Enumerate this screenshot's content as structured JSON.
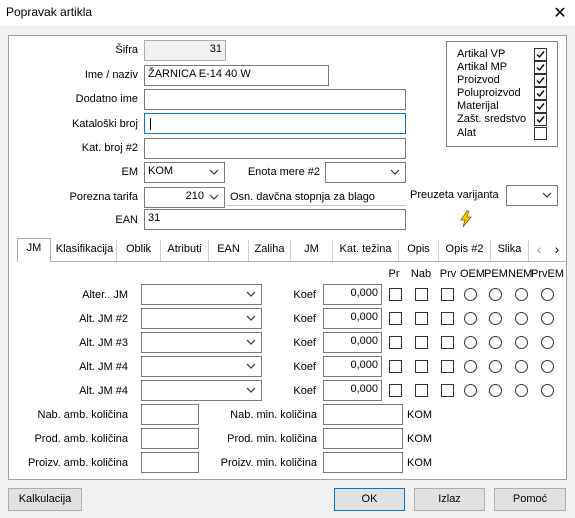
{
  "window": {
    "title": "Popravak artikla"
  },
  "fields": {
    "sifra_label": "Šifra",
    "sifra_value": "31",
    "ime_label": "Ime / naziv",
    "ime_value": "ŽARNICA E-14 40 W",
    "dodatno_label": "Dodatno ime",
    "dodatno_value": "",
    "katalog_label": "Kataloški broj",
    "katalog_value": "",
    "katalog2_label": "Kat. broj #2",
    "katalog2_value": "",
    "em_label": "EM",
    "em_value": "KOM",
    "enota2_label": "Enota mere #2",
    "enota2_value": "",
    "porez_label": "Porezna tarifa",
    "porez_value": "210",
    "porez_desc": "Osn. davčna stopnja za blago",
    "preuzeta_label": "Preuzeta varijanta",
    "preuzeta_value": "",
    "ean_label": "EAN",
    "ean_value": "31"
  },
  "flags": [
    {
      "label": "Artikal VP",
      "checked": true
    },
    {
      "label": "Artikal MP",
      "checked": true
    },
    {
      "label": "Proizvod",
      "checked": true
    },
    {
      "label": "Poluproizvod",
      "checked": true
    },
    {
      "label": "Materijal",
      "checked": true
    },
    {
      "label": "Zašt. sredstvo",
      "checked": true
    },
    {
      "label": "Alat",
      "checked": false
    }
  ],
  "tabs": [
    "JM",
    "Klasifikacija",
    "Oblik",
    "Atributi",
    "EAN",
    "Zaliha",
    "JM",
    "Kat. težina",
    "Opis",
    "Opis #2",
    "Slika"
  ],
  "tab_scroll": {
    "left": "‹",
    "right": "›"
  },
  "jm_headers": [
    "Pr",
    "Nab",
    "Prv",
    "OEM",
    "PEM",
    "NEM",
    "PrvEM"
  ],
  "jm_rows": [
    {
      "label": "Alter.. JM",
      "koef_label": "Koef",
      "koef": "0,000"
    },
    {
      "label": "Alt. JM #2",
      "koef_label": "Koef",
      "koef": "0,000"
    },
    {
      "label": "Alt. JM #3",
      "koef_label": "Koef",
      "koef": "0,000"
    },
    {
      "label": "Alt. JM #4",
      "koef_label": "Koef",
      "koef": "0,000"
    },
    {
      "label": "Alt. JM #4",
      "koef_label": "Koef",
      "koef": "0,000"
    }
  ],
  "amb": [
    {
      "left_label": "Nab. amb. količina",
      "right_label": "Nab. min. količina",
      "unit": "KOM"
    },
    {
      "left_label": "Prod. amb. količina",
      "right_label": "Prod. min. količina",
      "unit": "KOM"
    },
    {
      "left_label": "Proizv. amb. količina",
      "right_label": "Proizv. min. količina",
      "unit": "KOM"
    }
  ],
  "buttons": {
    "kalkulacija": "Kalkulacija",
    "ok": "OK",
    "izlaz": "Izlaz",
    "pomoc": "Pomoć"
  },
  "icons": {
    "lightning": "lightning-icon",
    "close": "close-icon"
  },
  "colors": {
    "accent": "#0078d7",
    "lightning": "#e8c000"
  }
}
